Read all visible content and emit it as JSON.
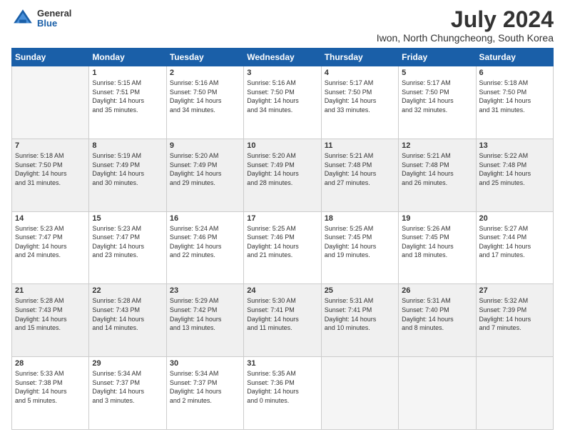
{
  "header": {
    "logo": {
      "general": "General",
      "blue": "Blue"
    },
    "title": "July 2024",
    "location": "Iwon, North Chungcheong, South Korea"
  },
  "calendar": {
    "days": [
      "Sunday",
      "Monday",
      "Tuesday",
      "Wednesday",
      "Thursday",
      "Friday",
      "Saturday"
    ],
    "weeks": [
      [
        {
          "day": "",
          "info": ""
        },
        {
          "day": "1",
          "info": "Sunrise: 5:15 AM\nSunset: 7:51 PM\nDaylight: 14 hours\nand 35 minutes."
        },
        {
          "day": "2",
          "info": "Sunrise: 5:16 AM\nSunset: 7:50 PM\nDaylight: 14 hours\nand 34 minutes."
        },
        {
          "day": "3",
          "info": "Sunrise: 5:16 AM\nSunset: 7:50 PM\nDaylight: 14 hours\nand 34 minutes."
        },
        {
          "day": "4",
          "info": "Sunrise: 5:17 AM\nSunset: 7:50 PM\nDaylight: 14 hours\nand 33 minutes."
        },
        {
          "day": "5",
          "info": "Sunrise: 5:17 AM\nSunset: 7:50 PM\nDaylight: 14 hours\nand 32 minutes."
        },
        {
          "day": "6",
          "info": "Sunrise: 5:18 AM\nSunset: 7:50 PM\nDaylight: 14 hours\nand 31 minutes."
        }
      ],
      [
        {
          "day": "7",
          "info": "Sunrise: 5:18 AM\nSunset: 7:50 PM\nDaylight: 14 hours\nand 31 minutes."
        },
        {
          "day": "8",
          "info": "Sunrise: 5:19 AM\nSunset: 7:49 PM\nDaylight: 14 hours\nand 30 minutes."
        },
        {
          "day": "9",
          "info": "Sunrise: 5:20 AM\nSunset: 7:49 PM\nDaylight: 14 hours\nand 29 minutes."
        },
        {
          "day": "10",
          "info": "Sunrise: 5:20 AM\nSunset: 7:49 PM\nDaylight: 14 hours\nand 28 minutes."
        },
        {
          "day": "11",
          "info": "Sunrise: 5:21 AM\nSunset: 7:48 PM\nDaylight: 14 hours\nand 27 minutes."
        },
        {
          "day": "12",
          "info": "Sunrise: 5:21 AM\nSunset: 7:48 PM\nDaylight: 14 hours\nand 26 minutes."
        },
        {
          "day": "13",
          "info": "Sunrise: 5:22 AM\nSunset: 7:48 PM\nDaylight: 14 hours\nand 25 minutes."
        }
      ],
      [
        {
          "day": "14",
          "info": "Sunrise: 5:23 AM\nSunset: 7:47 PM\nDaylight: 14 hours\nand 24 minutes."
        },
        {
          "day": "15",
          "info": "Sunrise: 5:23 AM\nSunset: 7:47 PM\nDaylight: 14 hours\nand 23 minutes."
        },
        {
          "day": "16",
          "info": "Sunrise: 5:24 AM\nSunset: 7:46 PM\nDaylight: 14 hours\nand 22 minutes."
        },
        {
          "day": "17",
          "info": "Sunrise: 5:25 AM\nSunset: 7:46 PM\nDaylight: 14 hours\nand 21 minutes."
        },
        {
          "day": "18",
          "info": "Sunrise: 5:25 AM\nSunset: 7:45 PM\nDaylight: 14 hours\nand 19 minutes."
        },
        {
          "day": "19",
          "info": "Sunrise: 5:26 AM\nSunset: 7:45 PM\nDaylight: 14 hours\nand 18 minutes."
        },
        {
          "day": "20",
          "info": "Sunrise: 5:27 AM\nSunset: 7:44 PM\nDaylight: 14 hours\nand 17 minutes."
        }
      ],
      [
        {
          "day": "21",
          "info": "Sunrise: 5:28 AM\nSunset: 7:43 PM\nDaylight: 14 hours\nand 15 minutes."
        },
        {
          "day": "22",
          "info": "Sunrise: 5:28 AM\nSunset: 7:43 PM\nDaylight: 14 hours\nand 14 minutes."
        },
        {
          "day": "23",
          "info": "Sunrise: 5:29 AM\nSunset: 7:42 PM\nDaylight: 14 hours\nand 13 minutes."
        },
        {
          "day": "24",
          "info": "Sunrise: 5:30 AM\nSunset: 7:41 PM\nDaylight: 14 hours\nand 11 minutes."
        },
        {
          "day": "25",
          "info": "Sunrise: 5:31 AM\nSunset: 7:41 PM\nDaylight: 14 hours\nand 10 minutes."
        },
        {
          "day": "26",
          "info": "Sunrise: 5:31 AM\nSunset: 7:40 PM\nDaylight: 14 hours\nand 8 minutes."
        },
        {
          "day": "27",
          "info": "Sunrise: 5:32 AM\nSunset: 7:39 PM\nDaylight: 14 hours\nand 7 minutes."
        }
      ],
      [
        {
          "day": "28",
          "info": "Sunrise: 5:33 AM\nSunset: 7:38 PM\nDaylight: 14 hours\nand 5 minutes."
        },
        {
          "day": "29",
          "info": "Sunrise: 5:34 AM\nSunset: 7:37 PM\nDaylight: 14 hours\nand 3 minutes."
        },
        {
          "day": "30",
          "info": "Sunrise: 5:34 AM\nSunset: 7:37 PM\nDaylight: 14 hours\nand 2 minutes."
        },
        {
          "day": "31",
          "info": "Sunrise: 5:35 AM\nSunset: 7:36 PM\nDaylight: 14 hours\nand 0 minutes."
        },
        {
          "day": "",
          "info": ""
        },
        {
          "day": "",
          "info": ""
        },
        {
          "day": "",
          "info": ""
        }
      ]
    ]
  }
}
